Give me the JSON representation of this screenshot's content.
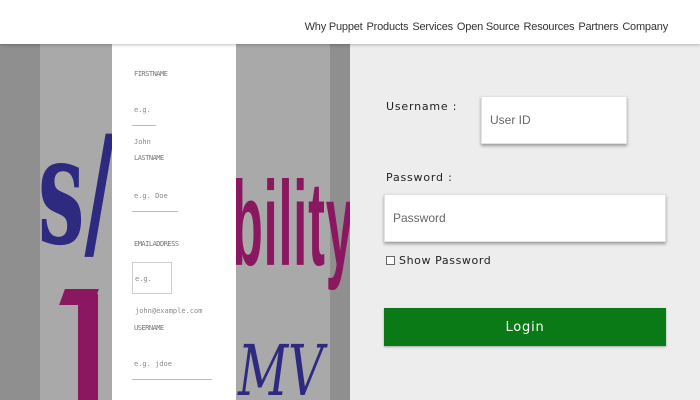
{
  "nav": {
    "links": [
      "Why Puppet",
      "Products",
      "Services",
      "Open Source",
      "Resources",
      "Partners",
      "Company"
    ]
  },
  "background": {
    "logo_left": "s/a",
    "logo_right": "bility",
    "logo_bottom": "MV"
  },
  "form_column": {
    "fields": [
      {
        "label": "FIRSTNAME",
        "value": "e.g. John"
      },
      {
        "label": "LASTNAME",
        "value": "e.g. Doe"
      },
      {
        "label": "EMAILADDRESS",
        "value": "e.g. john@example.com"
      },
      {
        "label": "USERNAME",
        "value": "e.g. jdoe"
      }
    ]
  },
  "login": {
    "username_label": "Username :",
    "username_placeholder": "User ID",
    "password_label": "Password :",
    "password_placeholder": "Password",
    "show_password_label": "Show Password",
    "login_button": "Login"
  },
  "colors": {
    "login_button": "#0a7a16",
    "logo_blue": "#2e2a80",
    "logo_magenta": "#8b1761"
  }
}
